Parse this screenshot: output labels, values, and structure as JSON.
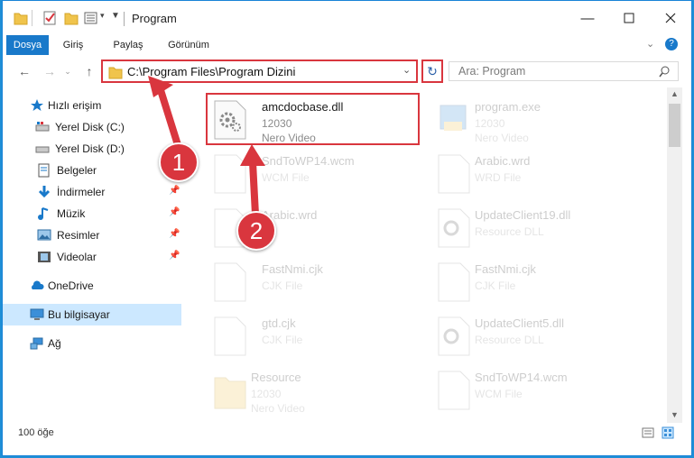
{
  "window": {
    "title": "Program"
  },
  "ribbon": {
    "tabs": [
      "Dosya",
      "Giriş",
      "Paylaş",
      "Görünüm"
    ]
  },
  "address": {
    "path": "C:\\Program Files\\Program Dizini"
  },
  "search": {
    "placeholder": "Ara: Program"
  },
  "sidebar": {
    "items": [
      {
        "label": "Hızlı erişim",
        "icon": "star-icon"
      },
      {
        "label": "Yerel Disk (C:)",
        "icon": "drive-icon"
      },
      {
        "label": "Yerel Disk (D:)",
        "icon": "drive-icon"
      },
      {
        "label": "Belgeler",
        "icon": "documents-icon"
      },
      {
        "label": "İndirmeler",
        "icon": "download-icon"
      },
      {
        "label": "Müzik",
        "icon": "music-icon"
      },
      {
        "label": "Resimler",
        "icon": "pictures-icon"
      },
      {
        "label": "Videolar",
        "icon": "videos-icon"
      },
      {
        "label": "OneDrive",
        "icon": "cloud-icon"
      },
      {
        "label": "Bu bilgisayar",
        "icon": "computer-icon"
      },
      {
        "label": "Ağ",
        "icon": "network-icon"
      }
    ]
  },
  "files": [
    {
      "name": "amcdocbase.dll",
      "line1": "12030",
      "line2": "Nero Video",
      "icon": "dll-gear-icon"
    },
    {
      "name": "program.exe",
      "line1": "12030",
      "line2": "Nero Video",
      "icon": "exe-icon"
    },
    {
      "name": "SndToWP14.wcm",
      "line1": "WCM File",
      "line2": "",
      "icon": "file-icon"
    },
    {
      "name": "Arabic.wrd",
      "line1": "WRD File",
      "line2": "",
      "icon": "file-icon"
    },
    {
      "name": "Arabic.wrd",
      "line1": "",
      "line2": "",
      "icon": "file-icon"
    },
    {
      "name": "UpdateClient19.dll",
      "line1": "Resource DLL",
      "line2": "",
      "icon": "dll-gear-icon"
    },
    {
      "name": "FastNmi.cjk",
      "line1": "CJK File",
      "line2": "",
      "icon": "file-icon"
    },
    {
      "name": "FastNmi.cjk",
      "line1": "CJK File",
      "line2": "",
      "icon": "file-icon"
    },
    {
      "name": "gtd.cjk",
      "line1": "CJK File",
      "line2": "",
      "icon": "file-icon"
    },
    {
      "name": "UpdateClient5.dll",
      "line1": "Resource DLL",
      "line2": "",
      "icon": "dll-gear-icon"
    },
    {
      "name": "Resource",
      "line1": "12030",
      "line2": "Nero Video",
      "icon": "folder-icon"
    },
    {
      "name": "SndToWP14.wcm",
      "line1": "WCM File",
      "line2": "",
      "icon": "file-icon"
    }
  ],
  "status": {
    "count": "100 öğe"
  },
  "annotations": {
    "step1": "1",
    "step2": "2"
  },
  "colors": {
    "accent": "#1979ca",
    "highlight": "#d9363e",
    "selection": "#cce8ff"
  }
}
